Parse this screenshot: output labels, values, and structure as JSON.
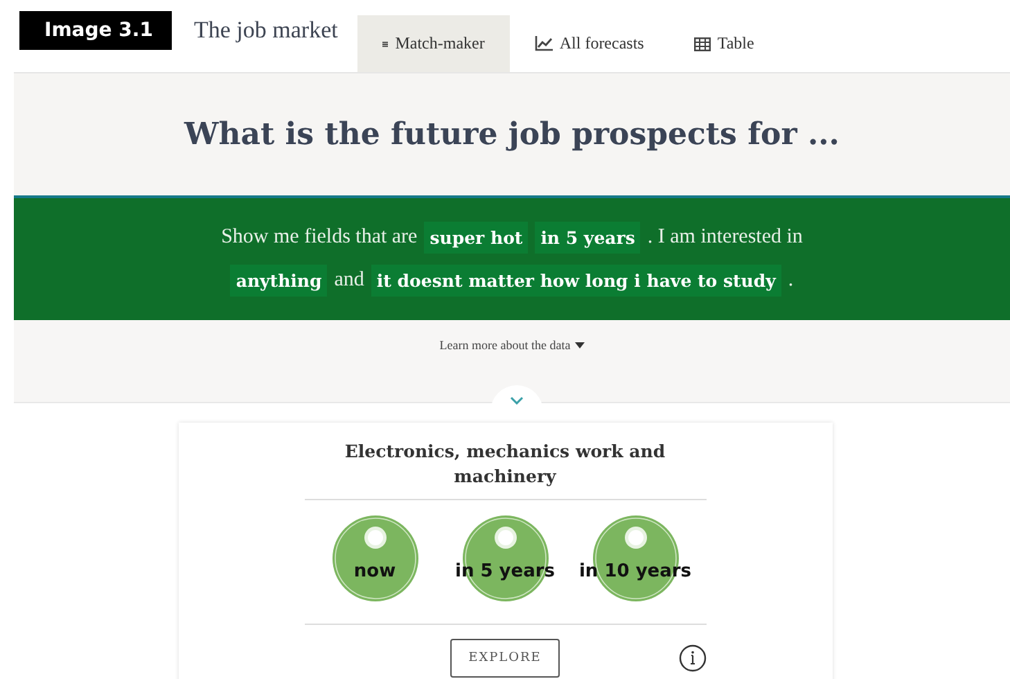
{
  "badge": "Image 3.1",
  "site_title": "The job market",
  "tabs": [
    {
      "label": "Match-maker",
      "kind": "list",
      "selected": true
    },
    {
      "label": "All forecasts",
      "kind": "chart",
      "selected": false
    },
    {
      "label": "Table",
      "kind": "table",
      "selected": false
    }
  ],
  "heading": "What is the future job prospects for ...",
  "sentence": [
    {
      "kind": "text",
      "text": "Show me fields that are"
    },
    {
      "kind": "choice",
      "text": "super hot"
    },
    {
      "kind": "choice",
      "text": "in 5 years"
    },
    {
      "kind": "text",
      "text": ". I am interested in"
    },
    {
      "kind": "break"
    },
    {
      "kind": "choice",
      "text": "anything"
    },
    {
      "kind": "text",
      "text": "and"
    },
    {
      "kind": "choice",
      "text": "it doesnt matter how long i have to study"
    },
    {
      "kind": "text",
      "text": "."
    }
  ],
  "learn_more": "Learn more about the data",
  "card": {
    "title": "Electronics, mechanics work and machinery",
    "periods": [
      {
        "label": "now"
      },
      {
        "label": "in 5 years"
      },
      {
        "label": "in 10 years"
      }
    ],
    "button": "EXPLORE"
  }
}
